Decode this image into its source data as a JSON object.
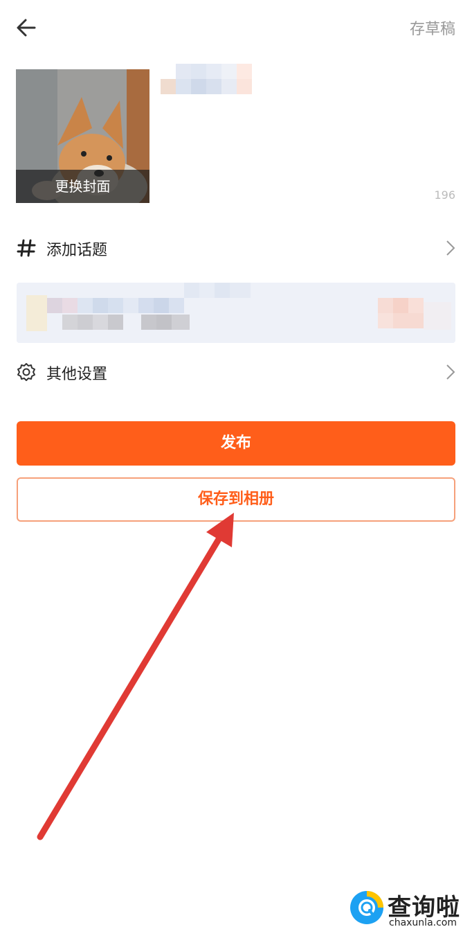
{
  "header": {
    "back_icon": "arrow-left-icon",
    "draft_label": "存草稿"
  },
  "cover": {
    "caption": "更换封面"
  },
  "title": {
    "char_count": "196"
  },
  "rows": {
    "topic": {
      "icon": "hash-icon",
      "label": "添加话题"
    },
    "settings": {
      "icon": "gear-icon",
      "label": "其他设置"
    }
  },
  "buttons": {
    "publish": "发布",
    "save_album": "保存到相册"
  },
  "colors": {
    "accent": "#ff5e1a",
    "outline": "#f6a07a",
    "annotation_arrow": "#e03a34"
  },
  "watermark": {
    "title": "查询啦",
    "url": "chaxunla.com"
  }
}
